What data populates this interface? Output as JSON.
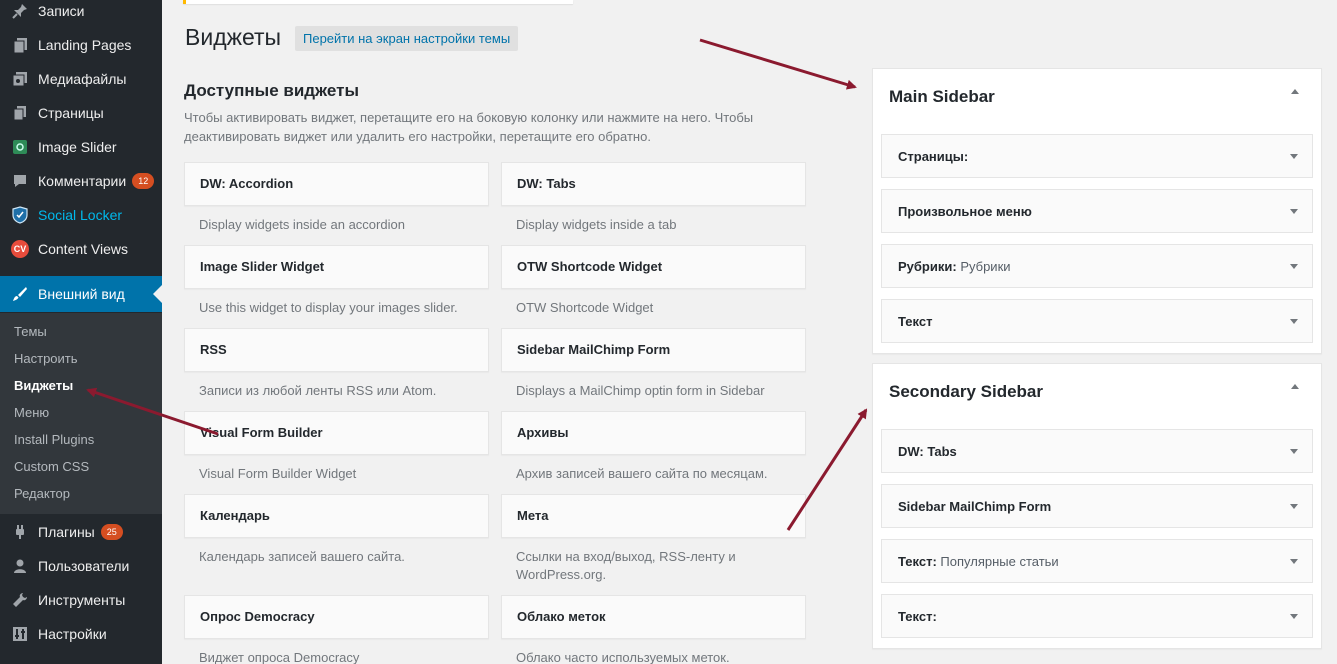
{
  "sidebar": {
    "items": [
      {
        "label": "Записи",
        "icon": "pin-icon"
      },
      {
        "label": "Landing Pages",
        "icon": "pages-icon"
      },
      {
        "label": "Медиафайлы",
        "icon": "media-icon"
      },
      {
        "label": "Страницы",
        "icon": "page-icon"
      },
      {
        "label": "Image Slider",
        "icon": "image-slider-icon"
      },
      {
        "label": "Комментарии",
        "icon": "comment-icon",
        "badge": "12"
      },
      {
        "label": "Social Locker",
        "icon": "shield-icon"
      },
      {
        "label": "Content Views",
        "icon": "cv-icon",
        "icon_text": "CV"
      },
      {
        "label": "Внешний вид",
        "icon": "paintbrush-icon"
      },
      {
        "label": "Плагины",
        "icon": "plugin-icon",
        "badge": "25"
      },
      {
        "label": "Пользователи",
        "icon": "user-icon"
      },
      {
        "label": "Инструменты",
        "icon": "wrench-icon"
      },
      {
        "label": "Настройки",
        "icon": "settings-icon"
      }
    ],
    "submenu": [
      "Темы",
      "Настроить",
      "Виджеты",
      "Меню",
      "Install Plugins",
      "Custom CSS",
      "Редактор"
    ]
  },
  "header": {
    "title": "Виджеты",
    "customize_link": "Перейти на экран настройки темы"
  },
  "available": {
    "title": "Доступные виджеты",
    "description": "Чтобы активировать виджет, перетащите его на боковую колонку или нажмите на него. Чтобы деактивировать виджет или удалить его настройки, перетащите его обратно.",
    "widgets": [
      {
        "title": "DW: Accordion",
        "desc": "Display widgets inside an accordion"
      },
      {
        "title": "DW: Tabs",
        "desc": "Display widgets inside a tab"
      },
      {
        "title": "Image Slider Widget",
        "desc": "Use this widget to display your images slider."
      },
      {
        "title": "OTW Shortcode Widget",
        "desc": "OTW Shortcode Widget"
      },
      {
        "title": "RSS",
        "desc": "Записи из любой ленты RSS или Atom."
      },
      {
        "title": "Sidebar MailChimp Form",
        "desc": "Displays a MailChimp optin form in Sidebar"
      },
      {
        "title": "Visual Form Builder",
        "desc": "Visual Form Builder Widget"
      },
      {
        "title": "Архивы",
        "desc": "Архив записей вашего сайта по месяцам."
      },
      {
        "title": "Календарь",
        "desc": "Календарь записей вашего сайта."
      },
      {
        "title": "Мета",
        "desc": "Ссылки на вход/выход, RSS-ленту и WordPress.org."
      },
      {
        "title": "Опрос Democracy",
        "desc": "Виджет опроса Democracy"
      },
      {
        "title": "Облако меток",
        "desc": "Облако часто используемых меток."
      }
    ]
  },
  "sidebars": [
    {
      "title": "Main Sidebar",
      "widgets": [
        {
          "label": "Страницы:",
          "sub": ""
        },
        {
          "label": "Произвольное меню",
          "sub": ""
        },
        {
          "label": "Рубрики:",
          "sub": " Рубрики"
        },
        {
          "label": "Текст",
          "sub": ""
        }
      ]
    },
    {
      "title": "Secondary Sidebar",
      "widgets": [
        {
          "label": "DW: Tabs",
          "sub": ""
        },
        {
          "label": "Sidebar MailChimp Form",
          "sub": ""
        },
        {
          "label": "Текст:",
          "sub": " Популярные статьи"
        },
        {
          "label": "Текст:",
          "sub": ""
        }
      ]
    }
  ],
  "colors": {
    "sidebar_bg": "#23282d",
    "submenu_bg": "#32373c",
    "accent": "#0073aa",
    "badge": "#d54e21",
    "annotation_arrow": "#8b1a2f"
  }
}
